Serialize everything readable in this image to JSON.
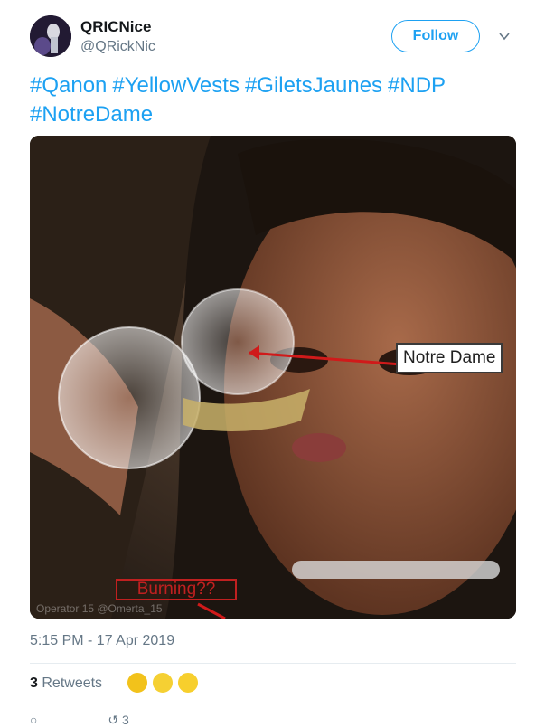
{
  "header": {
    "display_name": "QRICNice",
    "handle": "@QRickNic",
    "follow_label": "Follow",
    "avatar_icon": "avatar-image",
    "chevron_icon": "chevron-down-icon"
  },
  "tweet": {
    "hashtags": [
      "#Qanon",
      "#YellowVests",
      "#GiletsJaunes",
      "#NDP",
      "#NotreDame"
    ],
    "link_color": "#1da1f2"
  },
  "media": {
    "label_notre": "Notre Dame",
    "label_burning": "Burning??",
    "watermark": "Operator 15 @Omerta_15"
  },
  "meta": {
    "timestamp": "5:15 PM - 17 Apr 2019",
    "retweet_count": "3",
    "retweet_label": "Retweets",
    "reply_count": "",
    "retweet_action_count": "3"
  }
}
